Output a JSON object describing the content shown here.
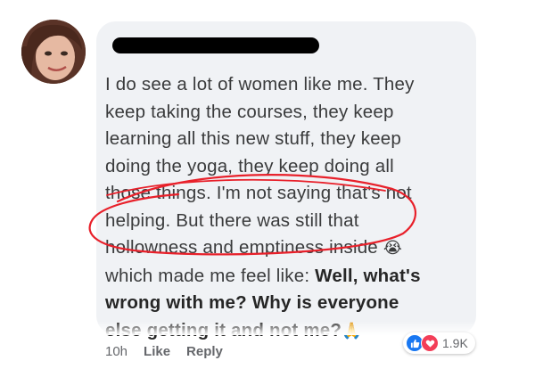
{
  "comment": {
    "lines": [
      "I do see a lot of women like me. They",
      "keep taking the courses, they keep",
      "learning all this new stuff, they keep",
      "doing the yoga, they keep doing all",
      "those things. I'm not saying that's not",
      "helping. But there was still that",
      "hollowness and emptiness inside",
      "which made me feel like:"
    ],
    "emoji_crying": "😭",
    "bold_1": "Well, what's",
    "bold_2": "wrong with me? Why is everyone",
    "bold_3": "else getting it and not me?",
    "emoji_pray": "🙏"
  },
  "actions": {
    "time": "10h",
    "like_label": "Like",
    "reply_label": "Reply"
  },
  "reactions": {
    "count": "1.9K",
    "icons": [
      "like-icon",
      "love-icon"
    ]
  },
  "colors": {
    "bubble": "#f0f2f5",
    "text": "#3a3b3c",
    "annotation": "#e8202a",
    "like": "#1877f2",
    "love": "#f33e58"
  }
}
